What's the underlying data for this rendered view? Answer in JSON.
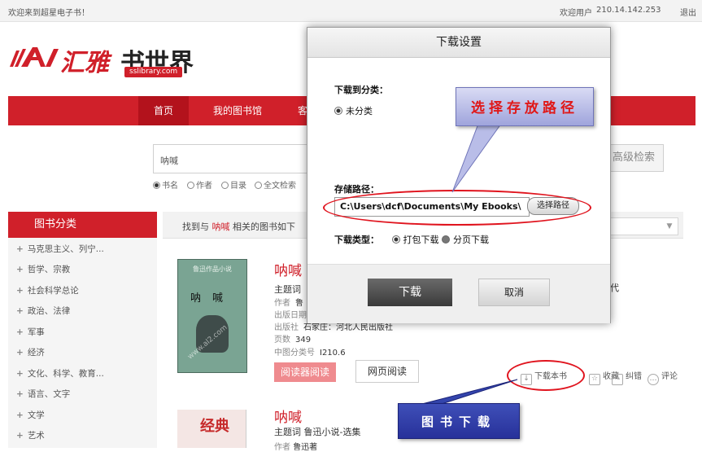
{
  "topbar": {
    "welcome": "欢迎来到超星电子书！",
    "user_label": "欢迎用户",
    "user_ip": "210.14.142.253",
    "logout": "退出"
  },
  "logo": {
    "name_part1": "汇雅",
    "name_part2": "书世界",
    "domain": "sslibrary.com"
  },
  "nav": {
    "home": "首页",
    "my_library": "我的图书馆",
    "client": "客户"
  },
  "search": {
    "value": "呐喊",
    "advanced": "高级检索",
    "options": [
      "书名",
      "作者",
      "目录",
      "全文检索"
    ],
    "selected_index": 0
  },
  "sidebar": {
    "title": "图书分类",
    "items": [
      "马克思主义、列宁...",
      "哲学、宗教",
      "社会科学总论",
      "政治、法律",
      "军事",
      "经济",
      "文化、科学、教育...",
      "语言、文字",
      "文学",
      "艺术"
    ]
  },
  "results": {
    "prefix": "找到与",
    "keyword": "呐喊",
    "suffix": "相关的图书如下"
  },
  "book1": {
    "title": "呐喊",
    "cover_title": "鲁迅作品小说",
    "cover_name": "呐喊",
    "cover_watermark": "www.al2.com",
    "meta": [
      {
        "label": "主题词",
        "value": ""
      },
      {
        "label": "作者",
        "value": "鲁"
      },
      {
        "label": "出版日期",
        "value": ""
      },
      {
        "label": "出版社",
        "value": "石家庄：河北人民出版社"
      },
      {
        "label": "页数",
        "value": "349"
      },
      {
        "label": "中图分类号",
        "value": "I210.6"
      }
    ],
    "read_app": "阅读器阅读",
    "read_web": "网页阅读",
    "trailing_text": "代"
  },
  "book1_actions": {
    "download": "下载本书",
    "favorite": "收藏",
    "correct": "纠错",
    "comment": "评论"
  },
  "book2": {
    "title": "呐喊",
    "subject_label": "主题词",
    "subject": "鲁迅小说-选集",
    "author_label": "作者",
    "author": "鲁迅著",
    "cover_text": "经典"
  },
  "dialog": {
    "title": "下载设置",
    "category_label": "下载到分类：",
    "uncategorized": "未分类",
    "path_label": "存储路径：",
    "path_value": "C:\\Users\\dcf\\Documents\\My Ebooks\\",
    "choose_path": "选择路径",
    "type_label": "下载类型：",
    "type_pack": "打包下载",
    "type_pages": "分页下载",
    "download": "下载",
    "cancel": "取消"
  },
  "annotations": {
    "choose_path_callout": "选择存放路径",
    "download_callout": "图书下载",
    "callout_text_color": "#e01818",
    "highlight_color": "#e0141e"
  },
  "colors": {
    "brand_red": "#d0202a",
    "nav_active": "#b3121c"
  }
}
